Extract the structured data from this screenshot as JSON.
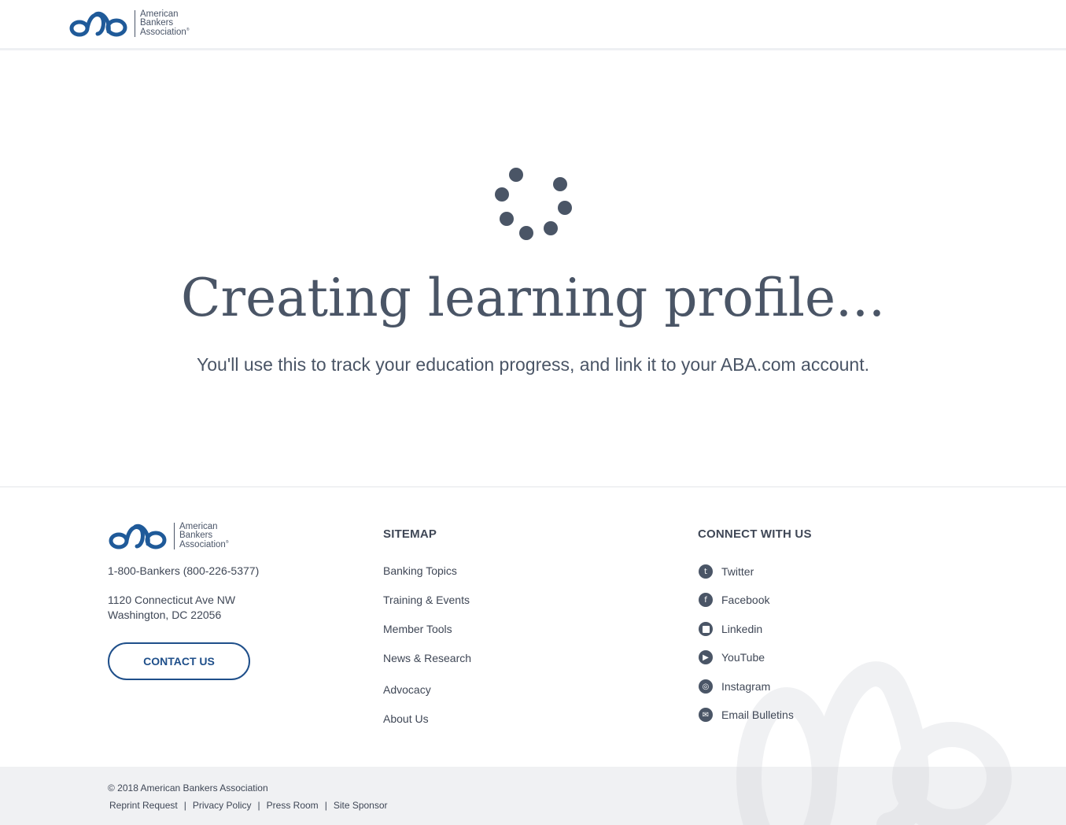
{
  "brand": {
    "line1": "American",
    "line2": "Bankers",
    "line3": "Association",
    "accent_color": "#1f5a99",
    "text_color": "#4a5566"
  },
  "main": {
    "title": "Creating learning profile...",
    "subtitle": "You'll use this to track your education progress, and link it to your ABA.com account."
  },
  "footer": {
    "phone": "1-800-Bankers (800-226-5377)",
    "address_line1": "1120 Connecticut Ave NW",
    "address_line2": "Washington, DC 22056",
    "contact_button": "CONTACT US",
    "sitemap": {
      "heading": "SITEMAP",
      "links": [
        "Banking Topics",
        "Training & Events",
        "Member Tools",
        "News & Research",
        "Advocacy",
        "About Us"
      ]
    },
    "connect": {
      "heading": "CONNECT WITH US",
      "links": [
        {
          "label": "Twitter",
          "icon": "twitter-icon"
        },
        {
          "label": "Facebook",
          "icon": "facebook-icon"
        },
        {
          "label": "Linkedin",
          "icon": "linkedin-icon"
        },
        {
          "label": "YouTube",
          "icon": "youtube-icon"
        },
        {
          "label": "Instagram",
          "icon": "instagram-icon"
        },
        {
          "label": "Email Bulletins",
          "icon": "email-icon"
        }
      ]
    }
  },
  "bottom": {
    "copyright": "© 2018 American Bankers Association",
    "links": [
      "Reprint Request",
      "Privacy Policy",
      "Press Room",
      "Site Sponsor"
    ],
    "separator": "|"
  }
}
